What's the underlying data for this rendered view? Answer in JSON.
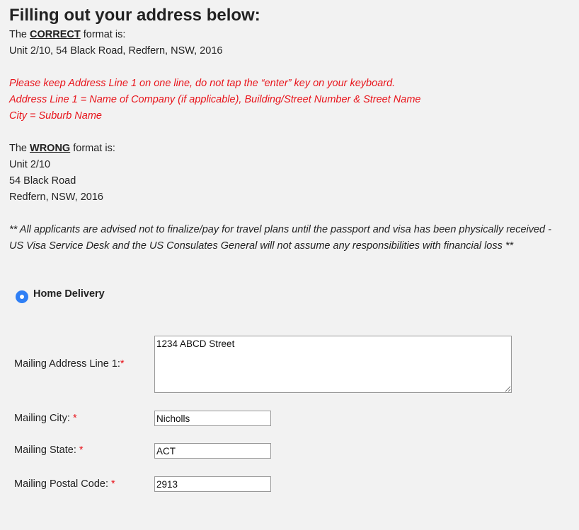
{
  "heading": "Filling out your address below:",
  "correct": {
    "prefix": "The ",
    "keyword": "CORRECT",
    "suffix": " format is:",
    "example": "Unit 2/10, 54 Black Road, Redfern, NSW, 2016"
  },
  "instructions": [
    "Please keep Address Line 1 on one line, do not tap the “enter” key on your keyboard.",
    "Address Line 1 = Name of Company (if applicable), Building/Street Number & Street Name",
    "City = Suburb Name"
  ],
  "wrong": {
    "prefix": "The ",
    "keyword": "WRONG",
    "suffix": " format is:",
    "lines": [
      "Unit 2/10",
      "54 Black Road",
      "Redfern, NSW, 2016"
    ]
  },
  "disclaimer": "** All applicants are advised not to finalize/pay for travel plans until the passport and visa has been physically received - US Visa Service Desk and the US Consulates General will not assume any responsibilities with financial loss **",
  "delivery": {
    "option_label": "Home Delivery",
    "selected": true
  },
  "form": {
    "address_line1": {
      "label": "Mailing Address Line 1:",
      "required_mark": "*",
      "value": "1234 ABCD Street"
    },
    "city": {
      "label": "Mailing City: ",
      "required_mark": "*",
      "value": "Nicholls"
    },
    "state": {
      "label": "Mailing State: ",
      "required_mark": "*",
      "value": "ACT"
    },
    "postal_code": {
      "label": "Mailing Postal Code: ",
      "required_mark": "*",
      "value": "2913"
    }
  },
  "colors": {
    "background": "#f2f2f2",
    "instruction_red": "#e8141b",
    "radio_blue": "#2f7ff5"
  }
}
